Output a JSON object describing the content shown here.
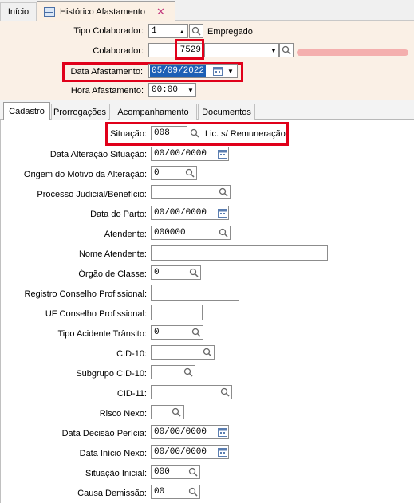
{
  "tabs": {
    "home": "Início",
    "history": "Histórico Afastamento"
  },
  "header": {
    "tipo_colaborador": {
      "label": "Tipo Colaborador:",
      "value": "1",
      "desc": "Empregado"
    },
    "colaborador": {
      "label": "Colaborador:",
      "value": "7529"
    },
    "data_afastamento": {
      "label": "Data Afastamento:",
      "value": "05/09/2022"
    },
    "hora_afastamento": {
      "label": "Hora Afastamento:",
      "value": "00:00"
    }
  },
  "subtabs": [
    "Cadastro",
    "Prorrogações",
    "Acompanhamento",
    "Documentos"
  ],
  "form": {
    "situacao": {
      "label": "Situação:",
      "value": "008",
      "desc": "Lic. s/ Remuneração"
    },
    "data_alteracao_situacao": {
      "label": "Data Alteração Situação:",
      "value": "00/00/0000"
    },
    "origem_motivo": {
      "label": "Origem do Motivo da Alteração:",
      "value": "0"
    },
    "processo_judicial": {
      "label": "Processo Judicial/Benefício:",
      "value": ""
    },
    "data_parto": {
      "label": "Data do Parto:",
      "value": "00/00/0000"
    },
    "atendente": {
      "label": "Atendente:",
      "value": "000000"
    },
    "nome_atendente": {
      "label": "Nome Atendente:",
      "value": ""
    },
    "orgao_classe": {
      "label": "Órgão de Classe:",
      "value": "0"
    },
    "registro_conselho": {
      "label": "Registro Conselho Profissional:",
      "value": ""
    },
    "uf_conselho": {
      "label": "UF Conselho Profissional:",
      "value": ""
    },
    "tipo_acidente": {
      "label": "Tipo Acidente Trânsito:",
      "value": "0"
    },
    "cid10": {
      "label": "CID-10:",
      "value": ""
    },
    "subgrupo_cid10": {
      "label": "Subgrupo CID-10:",
      "value": ""
    },
    "cid11": {
      "label": "CID-11:",
      "value": ""
    },
    "risco_nexo": {
      "label": "Risco Nexo:",
      "value": ""
    },
    "data_decisao_pericia": {
      "label": "Data Decisão Perícia:",
      "value": "00/00/0000"
    },
    "data_inicio_nexo": {
      "label": "Data Início Nexo:",
      "value": "00/00/0000"
    },
    "situacao_inicial": {
      "label": "Situação Inicial:",
      "value": "000"
    },
    "causa_demissao": {
      "label": "Causa Demissão:",
      "value": "00"
    }
  },
  "icons": {
    "search": "magnifier-icon",
    "calendar": "calendar-icon",
    "spinner": "spinner-arrows-icon",
    "close": "close-icon"
  },
  "colors": {
    "highlight": "#e0001a",
    "header_bg": "#faf0e6",
    "selection": "#1c5fb5"
  }
}
